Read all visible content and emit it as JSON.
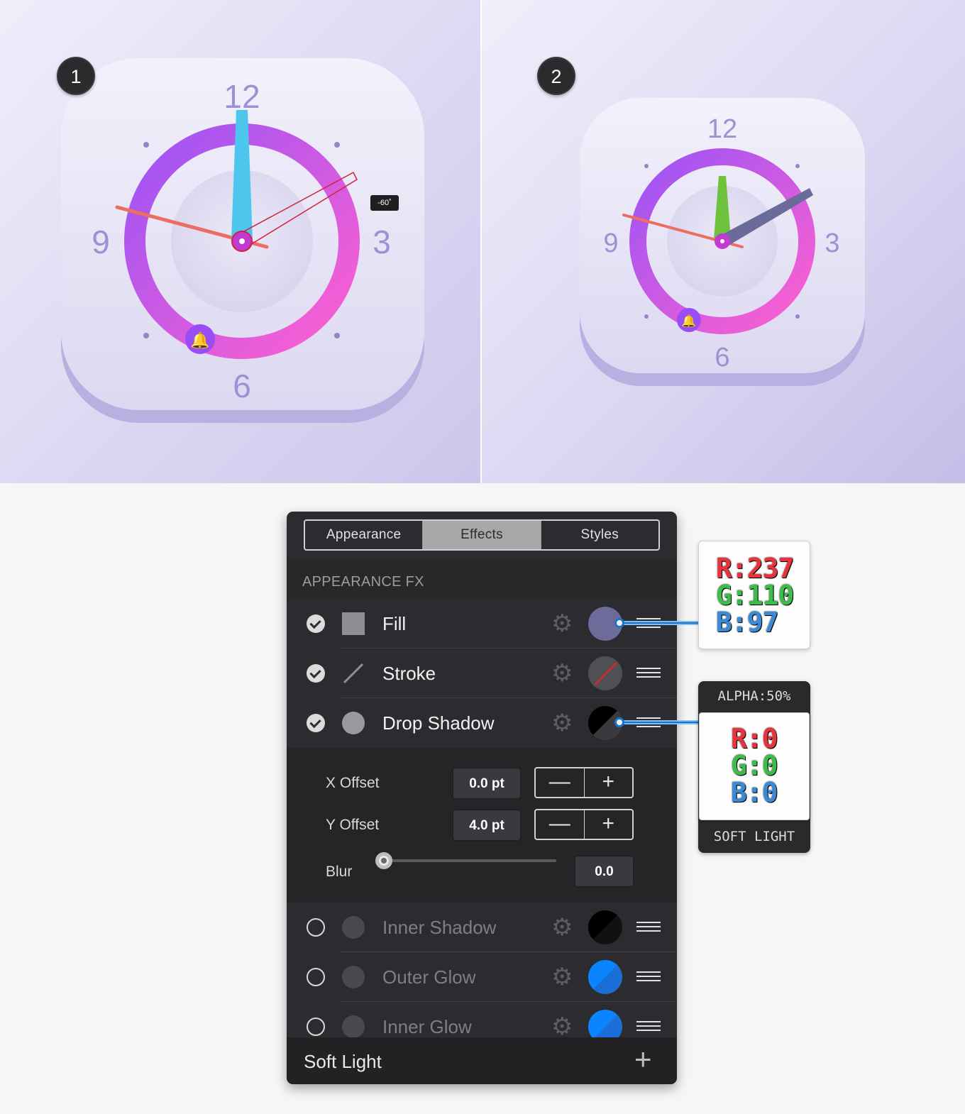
{
  "steps": [
    "1",
    "2"
  ],
  "clock": {
    "num_12": "12",
    "num_3": "3",
    "num_6": "6",
    "num_9": "9",
    "angle_tooltip": "-60˚",
    "colors": {
      "ring_start": "#a158f5",
      "ring_end": "#ff5fcf",
      "minute_hand_step1": "#4cc6ec",
      "minute_hand_step2": "#6ec23c",
      "hour_hand_step2": "#6b6b9a",
      "second_hand": "#ed6e61",
      "numerals": "#9a93d2"
    }
  },
  "effects_panel": {
    "tabs": [
      {
        "label": "Appearance",
        "active": false
      },
      {
        "label": "Effects",
        "active": true
      },
      {
        "label": "Styles",
        "active": false
      }
    ],
    "section_title": "APPEARANCE FX",
    "rows": [
      {
        "label": "Fill",
        "enabled": true,
        "icon": "square-icon",
        "swatch": "#6d6b9a"
      },
      {
        "label": "Stroke",
        "enabled": true,
        "icon": "line-icon",
        "swatch": "none"
      },
      {
        "label": "Drop Shadow",
        "enabled": true,
        "icon": "circle-icon",
        "swatch": "#000000"
      },
      {
        "label": "Inner Shadow",
        "enabled": false,
        "icon": "circle-icon",
        "swatch": "#000000"
      },
      {
        "label": "Outer Glow",
        "enabled": false,
        "icon": "circle-icon",
        "swatch": "#0a84ff"
      },
      {
        "label": "Inner Glow",
        "enabled": false,
        "icon": "circle-icon",
        "swatch": "#0a84ff"
      }
    ],
    "drop_shadow": {
      "x_offset_label": "X Offset",
      "x_offset_value": "0.0 pt",
      "y_offset_label": "Y Offset",
      "y_offset_value": "4.0 pt",
      "blur_label": "Blur",
      "blur_value": "0.0",
      "minus": "—",
      "plus": "+"
    },
    "footer_label": "Soft Light",
    "footer_add": "+"
  },
  "fill_color_callout": {
    "r": "R:237",
    "g": "G:110",
    "b": "B:97"
  },
  "shadow_color_callout": {
    "alpha": "ALPHA:50%",
    "r": "R:0",
    "g": "G:0",
    "b": "B:0",
    "blend": "SOFT LIGHT"
  }
}
